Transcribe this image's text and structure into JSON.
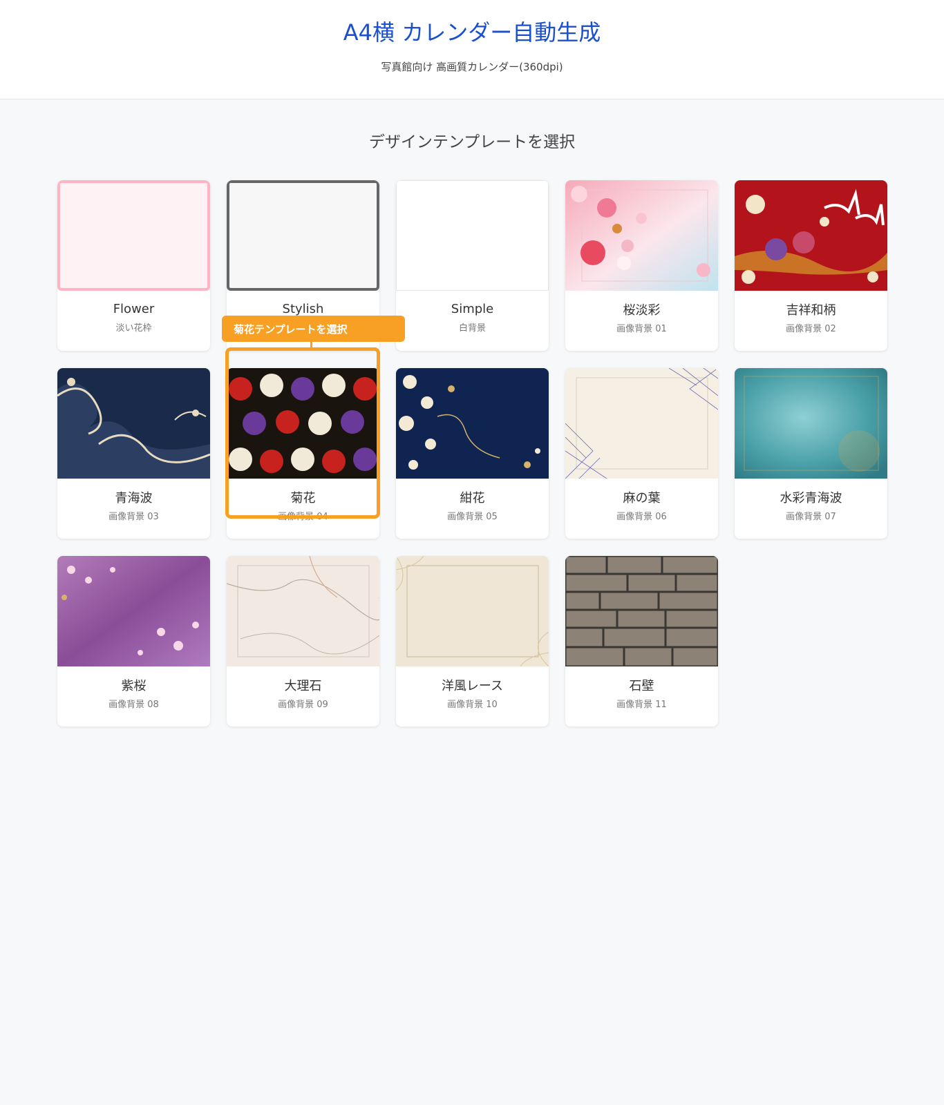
{
  "header": {
    "title": "A4横 カレンダー自動生成",
    "subtitle": "写真館向け 高画質カレンダー(360dpi)"
  },
  "section_title": "デザインテンプレートを選択",
  "templates": [
    {
      "name": "Flower",
      "sub": "淡い花枠"
    },
    {
      "name": "Stylish",
      "sub": ""
    },
    {
      "name": "Simple",
      "sub": "白背景"
    },
    {
      "name": "桜淡彩",
      "sub": "画像背景 01"
    },
    {
      "name": "吉祥和柄",
      "sub": "画像背景 02"
    },
    {
      "name": "青海波",
      "sub": "画像背景 03"
    },
    {
      "name": "菊花",
      "sub": "画像背景 04"
    },
    {
      "name": "紺花",
      "sub": "画像背景 05"
    },
    {
      "name": "麻の葉",
      "sub": "画像背景 06"
    },
    {
      "name": "水彩青海波",
      "sub": "画像背景 07"
    },
    {
      "name": "紫桜",
      "sub": "画像背景 08"
    },
    {
      "name": "大理石",
      "sub": "画像背景 09"
    },
    {
      "name": "洋風レース",
      "sub": "画像背景 10"
    },
    {
      "name": "石壁",
      "sub": "画像背景 11"
    }
  ],
  "callout": {
    "text": "菊花テンプレートを選択",
    "target": "菊花",
    "color": "#f7a023"
  },
  "colors": {
    "title": "#1a4fd0",
    "page_bg": "#f7f8fa",
    "highlight": "#f7a023"
  }
}
